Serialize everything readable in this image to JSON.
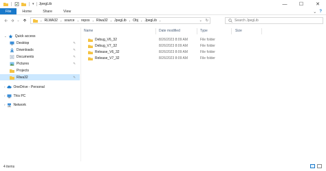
{
  "window": {
    "title": "JpegLib",
    "minimize_glyph": "—",
    "maximize_glyph": "☐",
    "close_glyph": "✕"
  },
  "ribbon": {
    "tabs": [
      "File",
      "Home",
      "Share",
      "View"
    ]
  },
  "address": {
    "crumbs": [
      "RLWA32",
      "source",
      "repos",
      "Rlwa32",
      "JpegLib",
      "Obj",
      "JpegLib"
    ]
  },
  "search": {
    "placeholder": "Search JpegLib"
  },
  "sidebar": {
    "items": [
      {
        "label": "Quick access",
        "icon": "star-icon",
        "pinned": false
      },
      {
        "label": "Desktop",
        "icon": "desktop-icon",
        "pinned": true
      },
      {
        "label": "Downloads",
        "icon": "download-icon",
        "pinned": true
      },
      {
        "label": "Documents",
        "icon": "documents-icon",
        "pinned": true
      },
      {
        "label": "Pictures",
        "icon": "pictures-icon",
        "pinned": true
      },
      {
        "label": "Projects",
        "icon": "folder-icon",
        "pinned": false
      },
      {
        "label": "Rlwa32",
        "icon": "folder-icon",
        "pinned": false,
        "selected": true
      },
      {
        "label": "OneDrive - Personal",
        "icon": "onedrive-icon",
        "pinned": false
      },
      {
        "label": "This PC",
        "icon": "pc-icon",
        "pinned": false
      },
      {
        "label": "Network",
        "icon": "network-icon",
        "pinned": false
      }
    ]
  },
  "columns": {
    "name": "Name",
    "date": "Date modified",
    "type": "Type",
    "size": "Size"
  },
  "files": [
    {
      "name": "Debug_V6_32",
      "date": "8/26/2023 8:09 AM",
      "type": "File folder"
    },
    {
      "name": "Debug_V7_32",
      "date": "8/26/2023 8:09 AM",
      "type": "File folder"
    },
    {
      "name": "Release_V6_32",
      "date": "8/26/2023 8:09 AM",
      "type": "File folder"
    },
    {
      "name": "Release_V7_32",
      "date": "8/26/2023 8:09 AM",
      "type": "File folder"
    }
  ],
  "status": {
    "item_count": "4 items"
  },
  "colors": {
    "accent": "#1979ca",
    "folder": "#f5c342",
    "selected": "#cce8ff"
  }
}
